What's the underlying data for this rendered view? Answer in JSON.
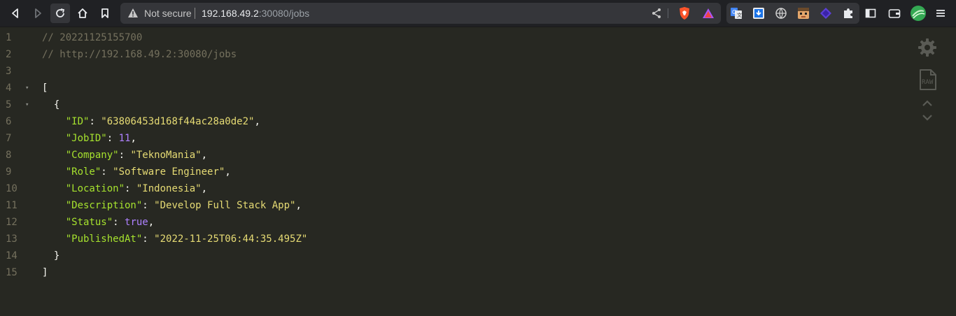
{
  "browser": {
    "security_label": "Not secure",
    "url_host": "192.168.49.2",
    "url_rest": ":30080/jobs",
    "icons": [
      "back-icon",
      "forward-icon",
      "reload-icon",
      "home-icon",
      "bookmark-icon",
      "share-icon",
      "brave-shields-icon",
      "brave-rewards-icon",
      "google-translate-icon",
      "download-extension-icon",
      "globe-extension-icon",
      "face-extension-icon",
      "diamond-extension-icon",
      "extensions-puzzle-icon",
      "sidebar-icon",
      "wallet-icon",
      "profile-avatar-icon",
      "menu-icon"
    ]
  },
  "viewer": {
    "lines": [
      {
        "n": "1",
        "parts": [
          [
            "cm",
            "// 20221125155700"
          ]
        ]
      },
      {
        "n": "2",
        "parts": [
          [
            "cm",
            "// http://192.168.49.2:30080/jobs"
          ]
        ]
      },
      {
        "n": "3",
        "parts": []
      },
      {
        "n": "4",
        "fold": true,
        "parts": [
          [
            "pun",
            "["
          ]
        ]
      },
      {
        "n": "5",
        "fold": true,
        "parts": [
          [
            "pun",
            "  {"
          ]
        ]
      },
      {
        "n": "6",
        "parts": [
          [
            "pun",
            "    "
          ],
          [
            "key",
            "\"ID\""
          ],
          [
            "pun",
            ": "
          ],
          [
            "str",
            "\"63806453d168f44ac28a0de2\""
          ],
          [
            "pun",
            ","
          ]
        ]
      },
      {
        "n": "7",
        "parts": [
          [
            "pun",
            "    "
          ],
          [
            "key",
            "\"JobID\""
          ],
          [
            "pun",
            ": "
          ],
          [
            "num",
            "11"
          ],
          [
            "pun",
            ","
          ]
        ]
      },
      {
        "n": "8",
        "parts": [
          [
            "pun",
            "    "
          ],
          [
            "key",
            "\"Company\""
          ],
          [
            "pun",
            ": "
          ],
          [
            "str",
            "\"TeknoMania\""
          ],
          [
            "pun",
            ","
          ]
        ]
      },
      {
        "n": "9",
        "parts": [
          [
            "pun",
            "    "
          ],
          [
            "key",
            "\"Role\""
          ],
          [
            "pun",
            ": "
          ],
          [
            "str",
            "\"Software Engineer\""
          ],
          [
            "pun",
            ","
          ]
        ]
      },
      {
        "n": "10",
        "parts": [
          [
            "pun",
            "    "
          ],
          [
            "key",
            "\"Location\""
          ],
          [
            "pun",
            ": "
          ],
          [
            "str",
            "\"Indonesia\""
          ],
          [
            "pun",
            ","
          ]
        ]
      },
      {
        "n": "11",
        "parts": [
          [
            "pun",
            "    "
          ],
          [
            "key",
            "\"Description\""
          ],
          [
            "pun",
            ": "
          ],
          [
            "str",
            "\"Develop Full Stack App\""
          ],
          [
            "pun",
            ","
          ]
        ]
      },
      {
        "n": "12",
        "parts": [
          [
            "pun",
            "    "
          ],
          [
            "key",
            "\"Status\""
          ],
          [
            "pun",
            ": "
          ],
          [
            "bool",
            "true"
          ],
          [
            "pun",
            ","
          ]
        ]
      },
      {
        "n": "13",
        "parts": [
          [
            "pun",
            "    "
          ],
          [
            "key",
            "\"PublishedAt\""
          ],
          [
            "pun",
            ": "
          ],
          [
            "str",
            "\"2022-11-25T06:44:35.495Z\""
          ]
        ]
      },
      {
        "n": "14",
        "parts": [
          [
            "pun",
            "  }"
          ]
        ]
      },
      {
        "n": "15",
        "parts": [
          [
            "pun",
            "]"
          ]
        ]
      }
    ],
    "raw_label": "RAW",
    "colors": {
      "background": "#272822",
      "comment": "#75715e",
      "key": "#a6e22e",
      "string": "#e6db74",
      "number": "#ae81ff"
    }
  }
}
